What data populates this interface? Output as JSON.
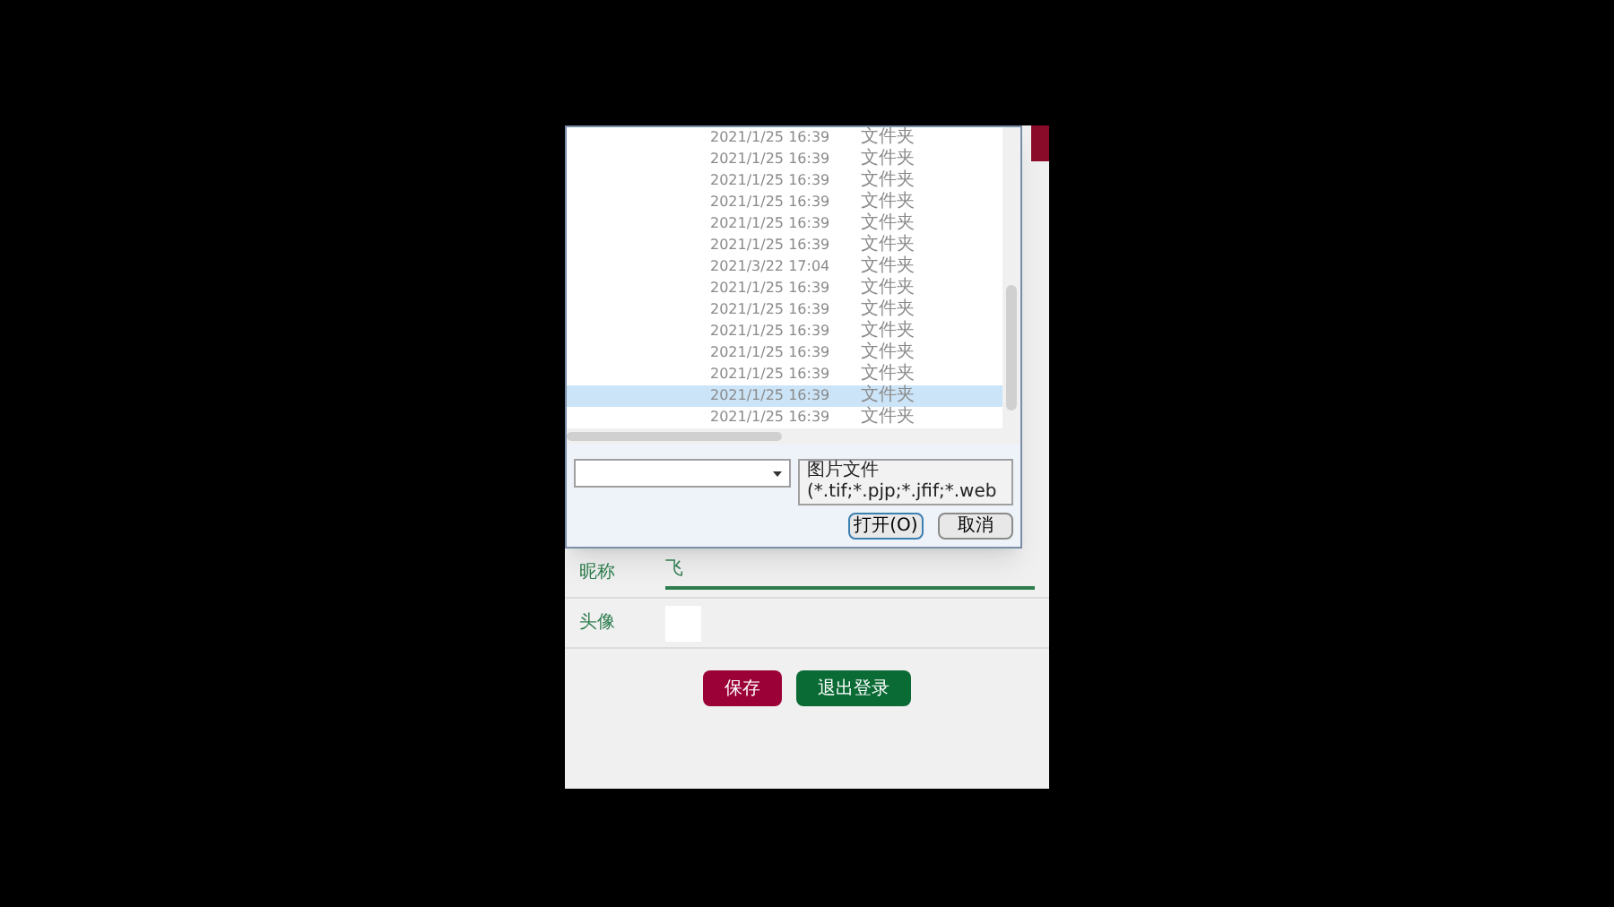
{
  "file_dialog": {
    "rows": [
      {
        "date": "2021/1/25 16:39",
        "type": "文件夹",
        "selected": false
      },
      {
        "date": "2021/1/25 16:39",
        "type": "文件夹",
        "selected": false
      },
      {
        "date": "2021/1/25 16:39",
        "type": "文件夹",
        "selected": false
      },
      {
        "date": "2021/1/25 16:39",
        "type": "文件夹",
        "selected": false
      },
      {
        "date": "2021/1/25 16:39",
        "type": "文件夹",
        "selected": false
      },
      {
        "date": "2021/1/25 16:39",
        "type": "文件夹",
        "selected": false
      },
      {
        "date": "2021/3/22 17:04",
        "type": "文件夹",
        "selected": false
      },
      {
        "date": "2021/1/25 16:39",
        "type": "文件夹",
        "selected": false
      },
      {
        "date": "2021/1/25 16:39",
        "type": "文件夹",
        "selected": false
      },
      {
        "date": "2021/1/25 16:39",
        "type": "文件夹",
        "selected": false
      },
      {
        "date": "2021/1/25 16:39",
        "type": "文件夹",
        "selected": false
      },
      {
        "date": "2021/1/25 16:39",
        "type": "文件夹",
        "selected": false
      },
      {
        "date": "2021/1/25 16:39",
        "type": "文件夹",
        "selected": true
      },
      {
        "date": "2021/1/25 16:39",
        "type": "文件夹",
        "selected": false
      }
    ],
    "file_type_filter": "图片文件 (*.tif;*.pjp;*.jfif;*.web",
    "buttons": [
      "打开(O)",
      "取消"
    ]
  },
  "form": {
    "fields": [
      {
        "kind": "text",
        "label": "昵称",
        "value": "飞"
      },
      {
        "kind": "image",
        "label": "头像"
      }
    ],
    "buttons": [
      {
        "label": "保存",
        "color": "#9b0036"
      },
      {
        "label": "退出登录",
        "color": "#0a6b35"
      }
    ]
  }
}
